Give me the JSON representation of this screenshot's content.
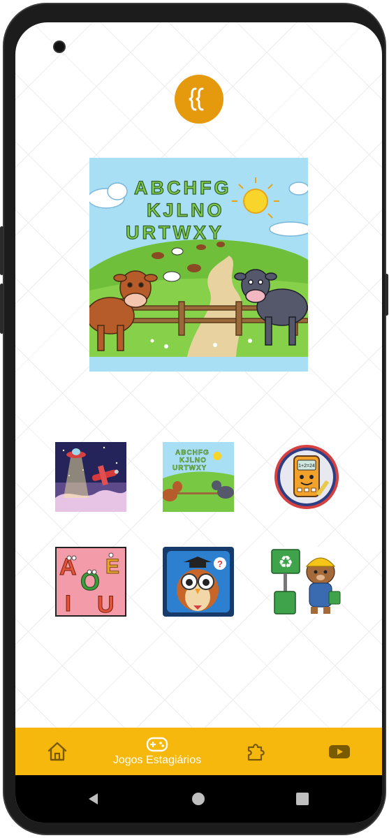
{
  "app": {
    "logo_icon": "curly-braces-icon",
    "accent": "#f6b80c",
    "logo_color": "#e59a0e"
  },
  "hero": {
    "title_letters": [
      "ABCHFG",
      "KJLNO",
      "URTWXY"
    ]
  },
  "games": [
    {
      "name": "space-game",
      "icon": "ufo-plane"
    },
    {
      "name": "alphabet-farm",
      "icon": "alphabet-cows"
    },
    {
      "name": "calculator",
      "icon": "calculator-character",
      "screen_text": "1+2=24"
    },
    {
      "name": "vowels",
      "icon": "vowels",
      "letters": [
        "A",
        "O",
        "E",
        "I",
        "U"
      ]
    },
    {
      "name": "owl-quiz",
      "icon": "owl-teacher"
    },
    {
      "name": "recycling",
      "icon": "recycling-bear"
    }
  ],
  "nav": {
    "items": [
      {
        "icon": "home-icon"
      },
      {
        "icon": "gamepad-icon",
        "label": "Jogos Estagiários"
      },
      {
        "icon": "puzzle-icon"
      },
      {
        "icon": "youtube-icon"
      }
    ]
  }
}
